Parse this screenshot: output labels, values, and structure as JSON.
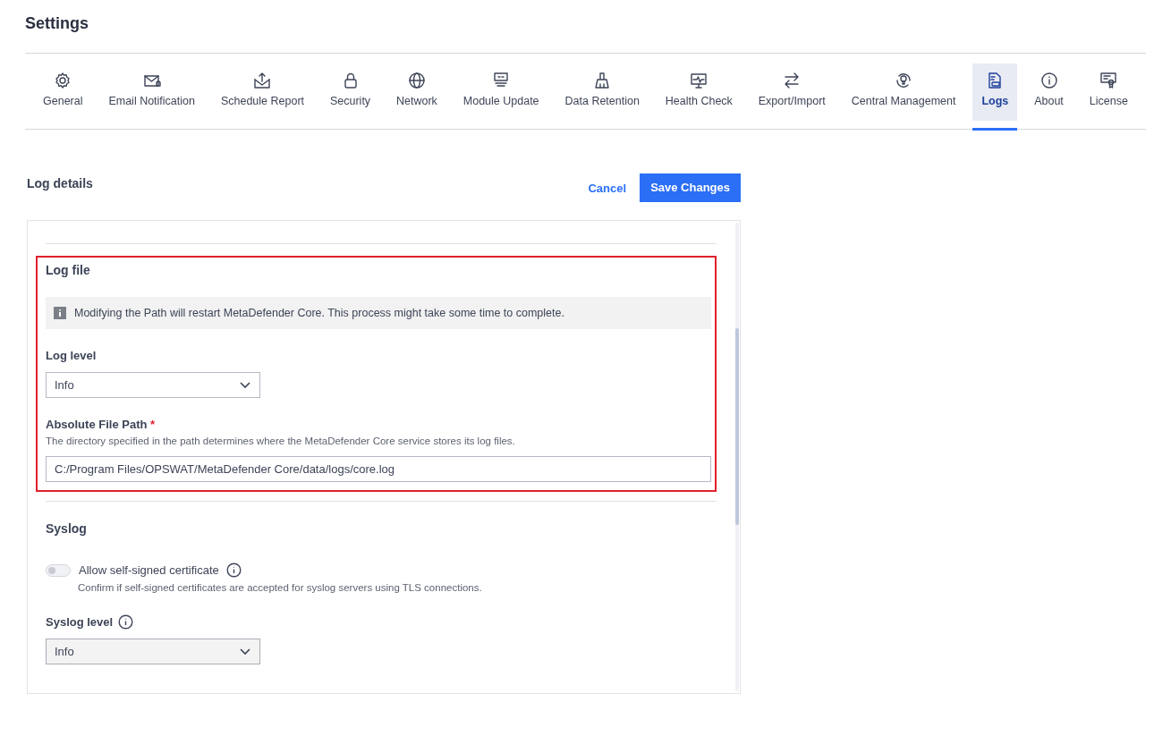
{
  "title": "Settings",
  "tabs": [
    {
      "label": "General",
      "selected": false
    },
    {
      "label": "Email Notification",
      "selected": false
    },
    {
      "label": "Schedule Report",
      "selected": false
    },
    {
      "label": "Security",
      "selected": false
    },
    {
      "label": "Network",
      "selected": false
    },
    {
      "label": "Module Update",
      "selected": false
    },
    {
      "label": "Data Retention",
      "selected": false
    },
    {
      "label": "Health Check",
      "selected": false
    },
    {
      "label": "Export/Import",
      "selected": false
    },
    {
      "label": "Central Management",
      "selected": false
    },
    {
      "label": "Logs",
      "selected": true
    },
    {
      "label": "About",
      "selected": false
    },
    {
      "label": "License",
      "selected": false
    }
  ],
  "section_title": "Log details",
  "actions": {
    "cancel": "Cancel",
    "save": "Save Changes"
  },
  "log_file": {
    "title": "Log file",
    "highlighted": true,
    "notice": "Modifying the Path will restart MetaDefender Core. This process might take some time to complete.",
    "log_level": {
      "label": "Log level",
      "value": "Info",
      "disabled": false
    },
    "file_path": {
      "label": "Absolute File Path",
      "required_mark": "*",
      "description": "The directory specified in the path determines where the MetaDefender Core service stores its log files.",
      "value": "C:/Program Files/OPSWAT/MetaDefender Core/data/logs/core.log"
    }
  },
  "syslog": {
    "title": "Syslog",
    "self_signed": {
      "label": "Allow self-signed certificate",
      "on": false,
      "description": "Confirm if self-signed certificates are accepted for syslog servers using TLS connections."
    },
    "syslog_level": {
      "label": "Syslog level",
      "value": "Info",
      "disabled": true
    }
  }
}
